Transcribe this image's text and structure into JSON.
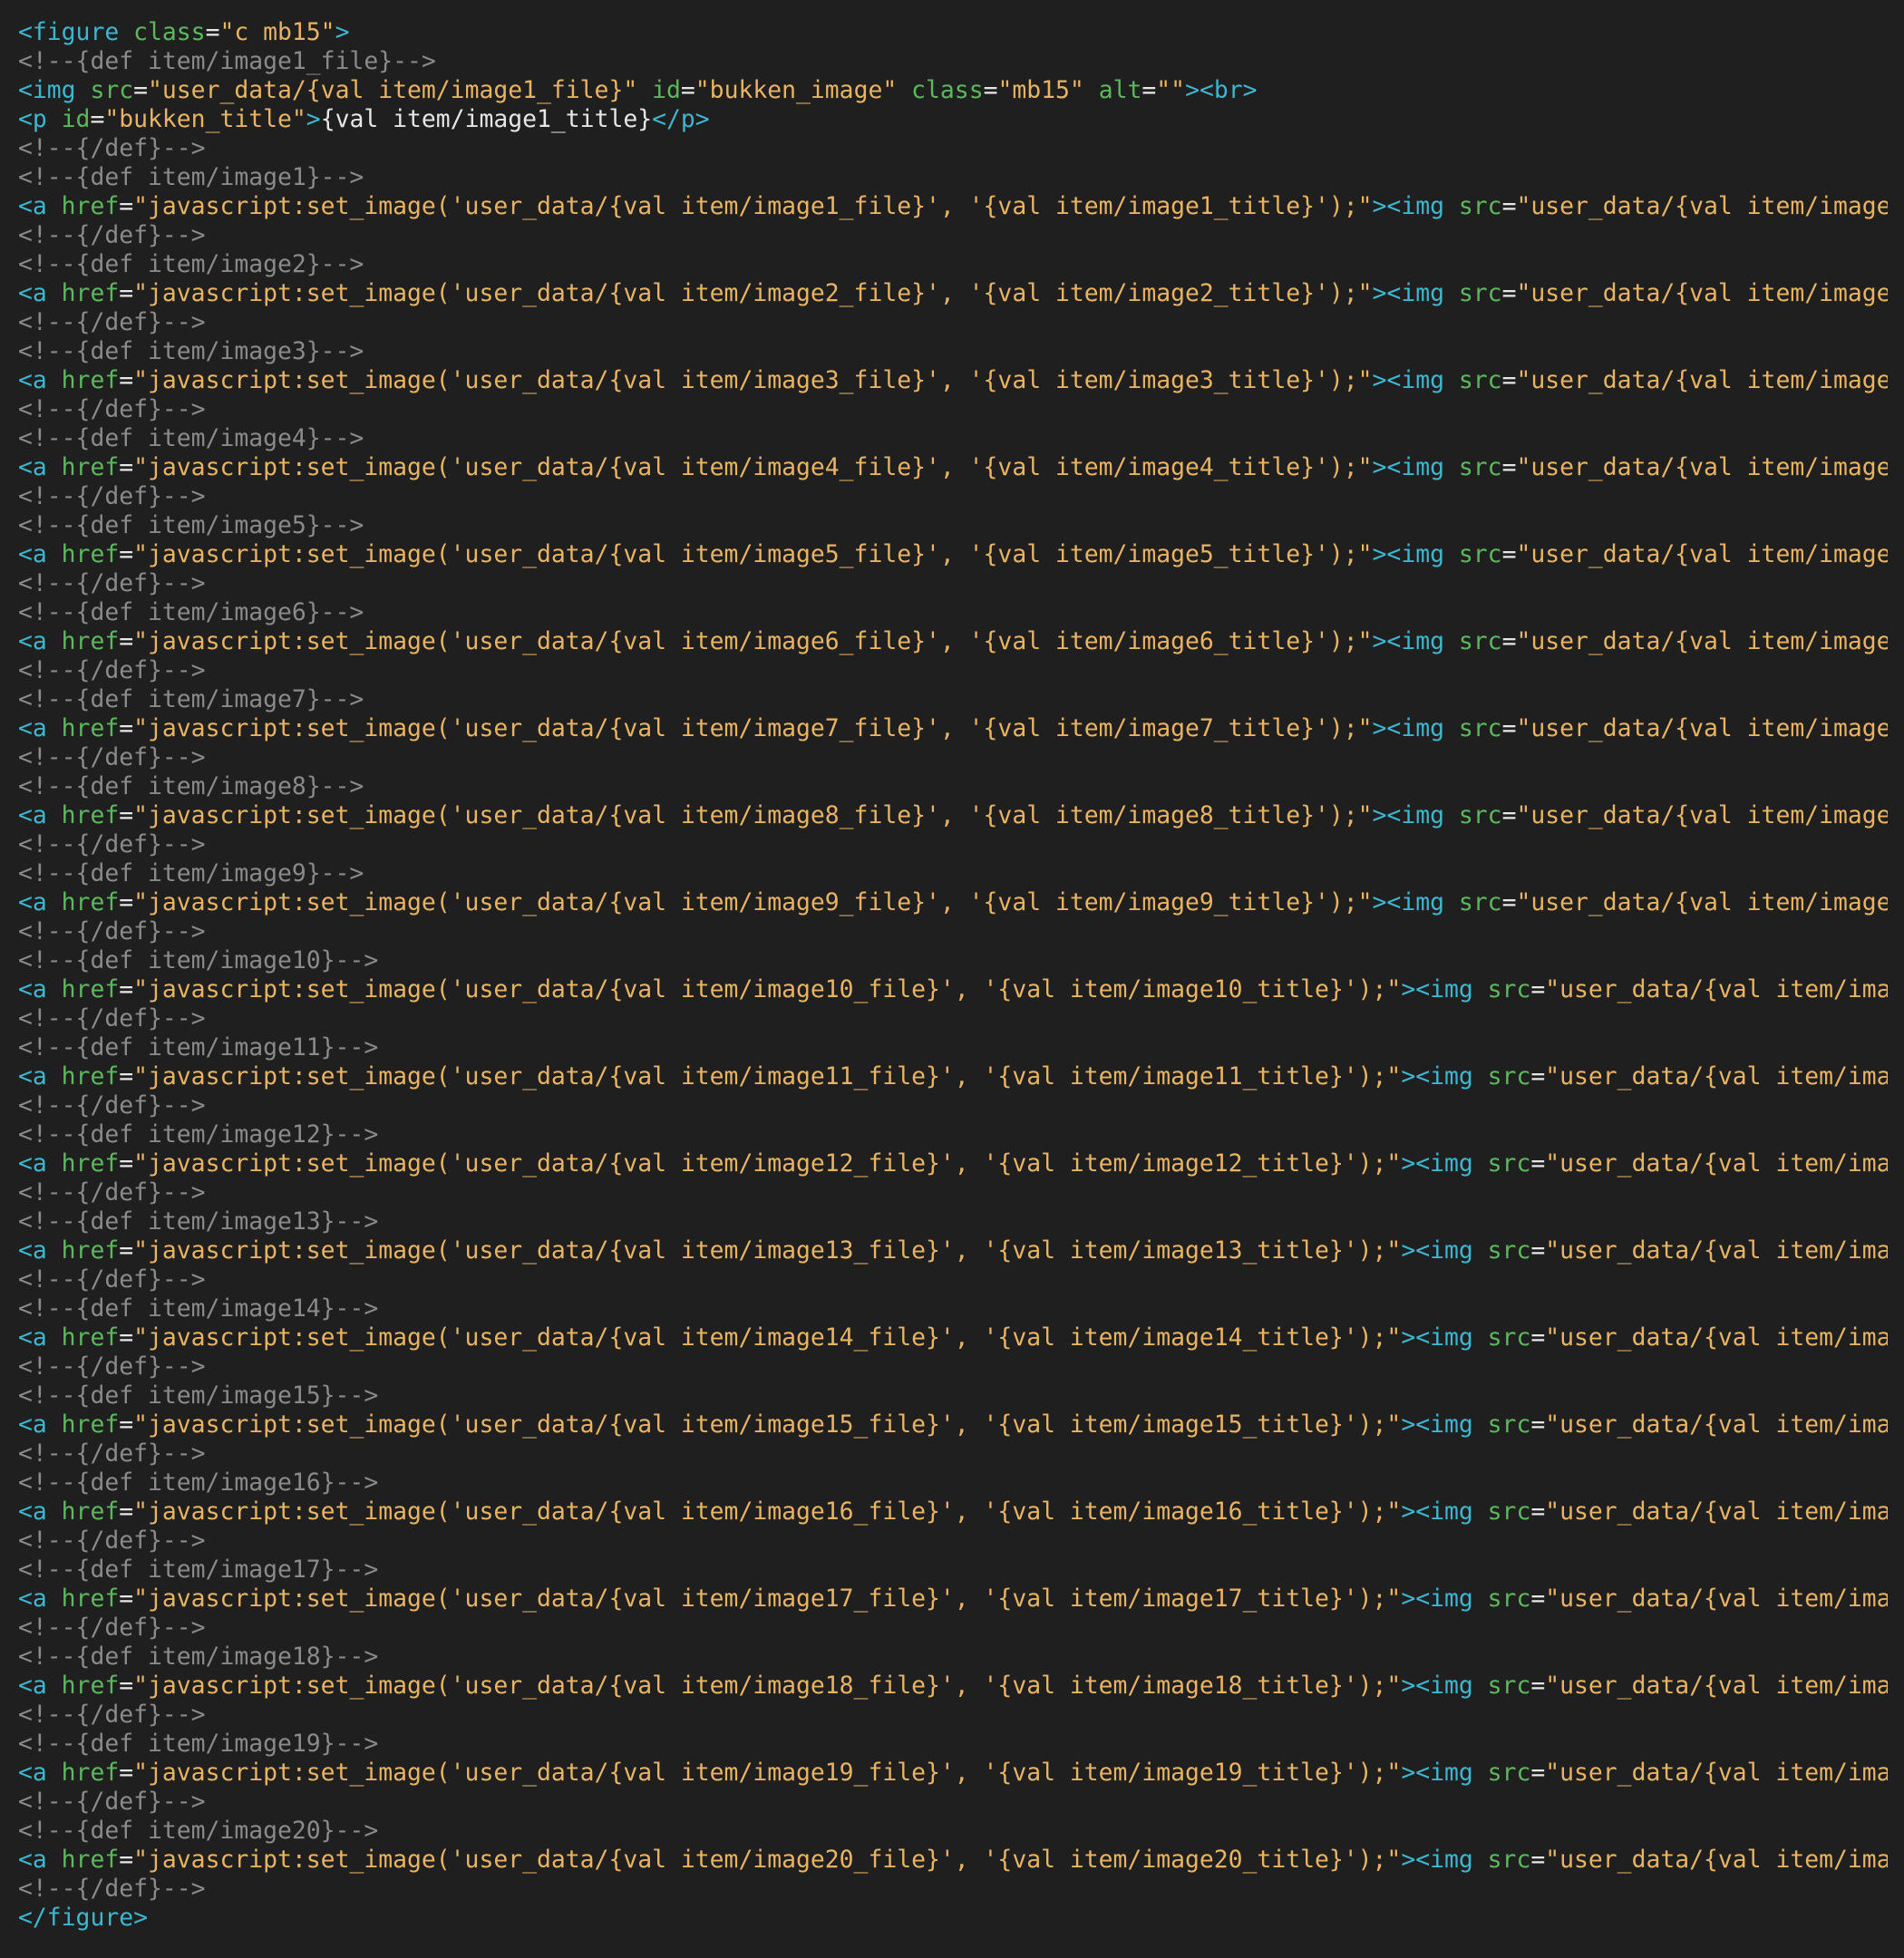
{
  "editor": {
    "colors": {
      "background": "#1f1f1f",
      "tag": "#3db6d0",
      "attribute": "#5cb85c",
      "string": "#e8b363",
      "comment": "#8a8a8a",
      "text": "#e6e6e6"
    },
    "lines": [
      [
        {
          "t": "tag",
          "v": "<figure "
        },
        {
          "t": "attr",
          "v": "class"
        },
        {
          "t": "text",
          "v": "="
        },
        {
          "t": "str",
          "v": "\"c mb15\""
        },
        {
          "t": "tag",
          "v": ">"
        }
      ],
      [
        {
          "t": "cmt",
          "v": "<!--{def item/image1_file}-->"
        }
      ],
      [
        {
          "t": "tag",
          "v": "<img "
        },
        {
          "t": "attr",
          "v": "src"
        },
        {
          "t": "text",
          "v": "="
        },
        {
          "t": "str",
          "v": "\"user_data/{val item/image1_file}\""
        },
        {
          "t": "text",
          "v": " "
        },
        {
          "t": "attr",
          "v": "id"
        },
        {
          "t": "text",
          "v": "="
        },
        {
          "t": "str",
          "v": "\"bukken_image\""
        },
        {
          "t": "text",
          "v": " "
        },
        {
          "t": "attr",
          "v": "class"
        },
        {
          "t": "text",
          "v": "="
        },
        {
          "t": "str",
          "v": "\"mb15\""
        },
        {
          "t": "text",
          "v": " "
        },
        {
          "t": "attr",
          "v": "alt"
        },
        {
          "t": "text",
          "v": "="
        },
        {
          "t": "str",
          "v": "\"\""
        },
        {
          "t": "tag",
          "v": "><br>"
        }
      ],
      [
        {
          "t": "tag",
          "v": "<p "
        },
        {
          "t": "attr",
          "v": "id"
        },
        {
          "t": "text",
          "v": "="
        },
        {
          "t": "str",
          "v": "\"bukken_title\""
        },
        {
          "t": "tag",
          "v": ">"
        },
        {
          "t": "text",
          "v": "{val item/image1_title}"
        },
        {
          "t": "tag",
          "v": "</p>"
        }
      ],
      [
        {
          "t": "cmt",
          "v": "<!--{/def}-->"
        }
      ],
      [
        {
          "t": "cmt",
          "v": "<!--{def item/image1}-->"
        }
      ],
      [
        {
          "t": "tag",
          "v": "<a "
        },
        {
          "t": "attr",
          "v": "href"
        },
        {
          "t": "text",
          "v": "="
        },
        {
          "t": "str",
          "v": "\"javascript:set_image('user_data/{val item/image1_file}', '{val item/image1_title}');\""
        },
        {
          "t": "tag",
          "v": "><img "
        },
        {
          "t": "attr",
          "v": "src"
        },
        {
          "t": "text",
          "v": "="
        },
        {
          "t": "str",
          "v": "\"user_data/{val item/image1_thumb}\""
        }
      ],
      [
        {
          "t": "cmt",
          "v": "<!--{/def}-->"
        }
      ],
      [
        {
          "t": "cmt",
          "v": "<!--{def item/image2}-->"
        }
      ],
      [
        {
          "t": "tag",
          "v": "<a "
        },
        {
          "t": "attr",
          "v": "href"
        },
        {
          "t": "text",
          "v": "="
        },
        {
          "t": "str",
          "v": "\"javascript:set_image('user_data/{val item/image2_file}', '{val item/image2_title}');\""
        },
        {
          "t": "tag",
          "v": "><img "
        },
        {
          "t": "attr",
          "v": "src"
        },
        {
          "t": "text",
          "v": "="
        },
        {
          "t": "str",
          "v": "\"user_data/{val item/image2_thumb}\""
        }
      ],
      [
        {
          "t": "cmt",
          "v": "<!--{/def}-->"
        }
      ],
      [
        {
          "t": "cmt",
          "v": "<!--{def item/image3}-->"
        }
      ],
      [
        {
          "t": "tag",
          "v": "<a "
        },
        {
          "t": "attr",
          "v": "href"
        },
        {
          "t": "text",
          "v": "="
        },
        {
          "t": "str",
          "v": "\"javascript:set_image('user_data/{val item/image3_file}', '{val item/image3_title}');\""
        },
        {
          "t": "tag",
          "v": "><img "
        },
        {
          "t": "attr",
          "v": "src"
        },
        {
          "t": "text",
          "v": "="
        },
        {
          "t": "str",
          "v": "\"user_data/{val item/image3_thumb}\""
        }
      ],
      [
        {
          "t": "cmt",
          "v": "<!--{/def}-->"
        }
      ],
      [
        {
          "t": "cmt",
          "v": "<!--{def item/image4}-->"
        }
      ],
      [
        {
          "t": "tag",
          "v": "<a "
        },
        {
          "t": "attr",
          "v": "href"
        },
        {
          "t": "text",
          "v": "="
        },
        {
          "t": "str",
          "v": "\"javascript:set_image('user_data/{val item/image4_file}', '{val item/image4_title}');\""
        },
        {
          "t": "tag",
          "v": "><img "
        },
        {
          "t": "attr",
          "v": "src"
        },
        {
          "t": "text",
          "v": "="
        },
        {
          "t": "str",
          "v": "\"user_data/{val item/image4_thumb}\""
        }
      ],
      [
        {
          "t": "cmt",
          "v": "<!--{/def}-->"
        }
      ],
      [
        {
          "t": "cmt",
          "v": "<!--{def item/image5}-->"
        }
      ],
      [
        {
          "t": "tag",
          "v": "<a "
        },
        {
          "t": "attr",
          "v": "href"
        },
        {
          "t": "text",
          "v": "="
        },
        {
          "t": "str",
          "v": "\"javascript:set_image('user_data/{val item/image5_file}', '{val item/image5_title}');\""
        },
        {
          "t": "tag",
          "v": "><img "
        },
        {
          "t": "attr",
          "v": "src"
        },
        {
          "t": "text",
          "v": "="
        },
        {
          "t": "str",
          "v": "\"user_data/{val item/image5_thumb}\""
        }
      ],
      [
        {
          "t": "cmt",
          "v": "<!--{/def}-->"
        }
      ],
      [
        {
          "t": "cmt",
          "v": "<!--{def item/image6}-->"
        }
      ],
      [
        {
          "t": "tag",
          "v": "<a "
        },
        {
          "t": "attr",
          "v": "href"
        },
        {
          "t": "text",
          "v": "="
        },
        {
          "t": "str",
          "v": "\"javascript:set_image('user_data/{val item/image6_file}', '{val item/image6_title}');\""
        },
        {
          "t": "tag",
          "v": "><img "
        },
        {
          "t": "attr",
          "v": "src"
        },
        {
          "t": "text",
          "v": "="
        },
        {
          "t": "str",
          "v": "\"user_data/{val item/image6_thumb}\""
        }
      ],
      [
        {
          "t": "cmt",
          "v": "<!--{/def}-->"
        }
      ],
      [
        {
          "t": "cmt",
          "v": "<!--{def item/image7}-->"
        }
      ],
      [
        {
          "t": "tag",
          "v": "<a "
        },
        {
          "t": "attr",
          "v": "href"
        },
        {
          "t": "text",
          "v": "="
        },
        {
          "t": "str",
          "v": "\"javascript:set_image('user_data/{val item/image7_file}', '{val item/image7_title}');\""
        },
        {
          "t": "tag",
          "v": "><img "
        },
        {
          "t": "attr",
          "v": "src"
        },
        {
          "t": "text",
          "v": "="
        },
        {
          "t": "str",
          "v": "\"user_data/{val item/image7_thumb}\""
        }
      ],
      [
        {
          "t": "cmt",
          "v": "<!--{/def}-->"
        }
      ],
      [
        {
          "t": "cmt",
          "v": "<!--{def item/image8}-->"
        }
      ],
      [
        {
          "t": "tag",
          "v": "<a "
        },
        {
          "t": "attr",
          "v": "href"
        },
        {
          "t": "text",
          "v": "="
        },
        {
          "t": "str",
          "v": "\"javascript:set_image('user_data/{val item/image8_file}', '{val item/image8_title}');\""
        },
        {
          "t": "tag",
          "v": "><img "
        },
        {
          "t": "attr",
          "v": "src"
        },
        {
          "t": "text",
          "v": "="
        },
        {
          "t": "str",
          "v": "\"user_data/{val item/image8_thumb}\""
        }
      ],
      [
        {
          "t": "cmt",
          "v": "<!--{/def}-->"
        }
      ],
      [
        {
          "t": "cmt",
          "v": "<!--{def item/image9}-->"
        }
      ],
      [
        {
          "t": "tag",
          "v": "<a "
        },
        {
          "t": "attr",
          "v": "href"
        },
        {
          "t": "text",
          "v": "="
        },
        {
          "t": "str",
          "v": "\"javascript:set_image('user_data/{val item/image9_file}', '{val item/image9_title}');\""
        },
        {
          "t": "tag",
          "v": "><img "
        },
        {
          "t": "attr",
          "v": "src"
        },
        {
          "t": "text",
          "v": "="
        },
        {
          "t": "str",
          "v": "\"user_data/{val item/image9_thumb}\""
        }
      ],
      [
        {
          "t": "cmt",
          "v": "<!--{/def}-->"
        }
      ],
      [
        {
          "t": "cmt",
          "v": "<!--{def item/image10}-->"
        }
      ],
      [
        {
          "t": "tag",
          "v": "<a "
        },
        {
          "t": "attr",
          "v": "href"
        },
        {
          "t": "text",
          "v": "="
        },
        {
          "t": "str",
          "v": "\"javascript:set_image('user_data/{val item/image10_file}', '{val item/image10_title}');\""
        },
        {
          "t": "tag",
          "v": "><img "
        },
        {
          "t": "attr",
          "v": "src"
        },
        {
          "t": "text",
          "v": "="
        },
        {
          "t": "str",
          "v": "\"user_data/{val item/image10_thumb}\""
        }
      ],
      [
        {
          "t": "cmt",
          "v": "<!--{/def}-->"
        }
      ],
      [
        {
          "t": "cmt",
          "v": "<!--{def item/image11}-->"
        }
      ],
      [
        {
          "t": "tag",
          "v": "<a "
        },
        {
          "t": "attr",
          "v": "href"
        },
        {
          "t": "text",
          "v": "="
        },
        {
          "t": "str",
          "v": "\"javascript:set_image('user_data/{val item/image11_file}', '{val item/image11_title}');\""
        },
        {
          "t": "tag",
          "v": "><img "
        },
        {
          "t": "attr",
          "v": "src"
        },
        {
          "t": "text",
          "v": "="
        },
        {
          "t": "str",
          "v": "\"user_data/{val item/image11_thumb}\""
        }
      ],
      [
        {
          "t": "cmt",
          "v": "<!--{/def}-->"
        }
      ],
      [
        {
          "t": "cmt",
          "v": "<!--{def item/image12}-->"
        }
      ],
      [
        {
          "t": "tag",
          "v": "<a "
        },
        {
          "t": "attr",
          "v": "href"
        },
        {
          "t": "text",
          "v": "="
        },
        {
          "t": "str",
          "v": "\"javascript:set_image('user_data/{val item/image12_file}', '{val item/image12_title}');\""
        },
        {
          "t": "tag",
          "v": "><img "
        },
        {
          "t": "attr",
          "v": "src"
        },
        {
          "t": "text",
          "v": "="
        },
        {
          "t": "str",
          "v": "\"user_data/{val item/image12_thumb}\""
        }
      ],
      [
        {
          "t": "cmt",
          "v": "<!--{/def}-->"
        }
      ],
      [
        {
          "t": "cmt",
          "v": "<!--{def item/image13}-->"
        }
      ],
      [
        {
          "t": "tag",
          "v": "<a "
        },
        {
          "t": "attr",
          "v": "href"
        },
        {
          "t": "text",
          "v": "="
        },
        {
          "t": "str",
          "v": "\"javascript:set_image('user_data/{val item/image13_file}', '{val item/image13_title}');\""
        },
        {
          "t": "tag",
          "v": "><img "
        },
        {
          "t": "attr",
          "v": "src"
        },
        {
          "t": "text",
          "v": "="
        },
        {
          "t": "str",
          "v": "\"user_data/{val item/image13_thumb}\""
        }
      ],
      [
        {
          "t": "cmt",
          "v": "<!--{/def}-->"
        }
      ],
      [
        {
          "t": "cmt",
          "v": "<!--{def item/image14}-->"
        }
      ],
      [
        {
          "t": "tag",
          "v": "<a "
        },
        {
          "t": "attr",
          "v": "href"
        },
        {
          "t": "text",
          "v": "="
        },
        {
          "t": "str",
          "v": "\"javascript:set_image('user_data/{val item/image14_file}', '{val item/image14_title}');\""
        },
        {
          "t": "tag",
          "v": "><img "
        },
        {
          "t": "attr",
          "v": "src"
        },
        {
          "t": "text",
          "v": "="
        },
        {
          "t": "str",
          "v": "\"user_data/{val item/image14_thumb}\""
        }
      ],
      [
        {
          "t": "cmt",
          "v": "<!--{/def}-->"
        }
      ],
      [
        {
          "t": "cmt",
          "v": "<!--{def item/image15}-->"
        }
      ],
      [
        {
          "t": "tag",
          "v": "<a "
        },
        {
          "t": "attr",
          "v": "href"
        },
        {
          "t": "text",
          "v": "="
        },
        {
          "t": "str",
          "v": "\"javascript:set_image('user_data/{val item/image15_file}', '{val item/image15_title}');\""
        },
        {
          "t": "tag",
          "v": "><img "
        },
        {
          "t": "attr",
          "v": "src"
        },
        {
          "t": "text",
          "v": "="
        },
        {
          "t": "str",
          "v": "\"user_data/{val item/image15_thumb}\""
        }
      ],
      [
        {
          "t": "cmt",
          "v": "<!--{/def}-->"
        }
      ],
      [
        {
          "t": "cmt",
          "v": "<!--{def item/image16}-->"
        }
      ],
      [
        {
          "t": "tag",
          "v": "<a "
        },
        {
          "t": "attr",
          "v": "href"
        },
        {
          "t": "text",
          "v": "="
        },
        {
          "t": "str",
          "v": "\"javascript:set_image('user_data/{val item/image16_file}', '{val item/image16_title}');\""
        },
        {
          "t": "tag",
          "v": "><img "
        },
        {
          "t": "attr",
          "v": "src"
        },
        {
          "t": "text",
          "v": "="
        },
        {
          "t": "str",
          "v": "\"user_data/{val item/image16_thumb}\""
        }
      ],
      [
        {
          "t": "cmt",
          "v": "<!--{/def}-->"
        }
      ],
      [
        {
          "t": "cmt",
          "v": "<!--{def item/image17}-->"
        }
      ],
      [
        {
          "t": "tag",
          "v": "<a "
        },
        {
          "t": "attr",
          "v": "href"
        },
        {
          "t": "text",
          "v": "="
        },
        {
          "t": "str",
          "v": "\"javascript:set_image('user_data/{val item/image17_file}', '{val item/image17_title}');\""
        },
        {
          "t": "tag",
          "v": "><img "
        },
        {
          "t": "attr",
          "v": "src"
        },
        {
          "t": "text",
          "v": "="
        },
        {
          "t": "str",
          "v": "\"user_data/{val item/image17_thumb}\""
        }
      ],
      [
        {
          "t": "cmt",
          "v": "<!--{/def}-->"
        }
      ],
      [
        {
          "t": "cmt",
          "v": "<!--{def item/image18}-->"
        }
      ],
      [
        {
          "t": "tag",
          "v": "<a "
        },
        {
          "t": "attr",
          "v": "href"
        },
        {
          "t": "text",
          "v": "="
        },
        {
          "t": "str",
          "v": "\"javascript:set_image('user_data/{val item/image18_file}', '{val item/image18_title}');\""
        },
        {
          "t": "tag",
          "v": "><img "
        },
        {
          "t": "attr",
          "v": "src"
        },
        {
          "t": "text",
          "v": "="
        },
        {
          "t": "str",
          "v": "\"user_data/{val item/image18_thumb}\""
        }
      ],
      [
        {
          "t": "cmt",
          "v": "<!--{/def}-->"
        }
      ],
      [
        {
          "t": "cmt",
          "v": "<!--{def item/image19}-->"
        }
      ],
      [
        {
          "t": "tag",
          "v": "<a "
        },
        {
          "t": "attr",
          "v": "href"
        },
        {
          "t": "text",
          "v": "="
        },
        {
          "t": "str",
          "v": "\"javascript:set_image('user_data/{val item/image19_file}', '{val item/image19_title}');\""
        },
        {
          "t": "tag",
          "v": "><img "
        },
        {
          "t": "attr",
          "v": "src"
        },
        {
          "t": "text",
          "v": "="
        },
        {
          "t": "str",
          "v": "\"user_data/{val item/image19_thumb}\""
        }
      ],
      [
        {
          "t": "cmt",
          "v": "<!--{/def}-->"
        }
      ],
      [
        {
          "t": "cmt",
          "v": "<!--{def item/image20}-->"
        }
      ],
      [
        {
          "t": "tag",
          "v": "<a "
        },
        {
          "t": "attr",
          "v": "href"
        },
        {
          "t": "text",
          "v": "="
        },
        {
          "t": "str",
          "v": "\"javascript:set_image('user_data/{val item/image20_file}', '{val item/image20_title}');\""
        },
        {
          "t": "tag",
          "v": "><img "
        },
        {
          "t": "attr",
          "v": "src"
        },
        {
          "t": "text",
          "v": "="
        },
        {
          "t": "str",
          "v": "\"user_data/{val item/image20_thumb}\""
        }
      ],
      [
        {
          "t": "cmt",
          "v": "<!--{/def}-->"
        }
      ],
      [
        {
          "t": "tag",
          "v": "</figure>"
        }
      ]
    ]
  }
}
